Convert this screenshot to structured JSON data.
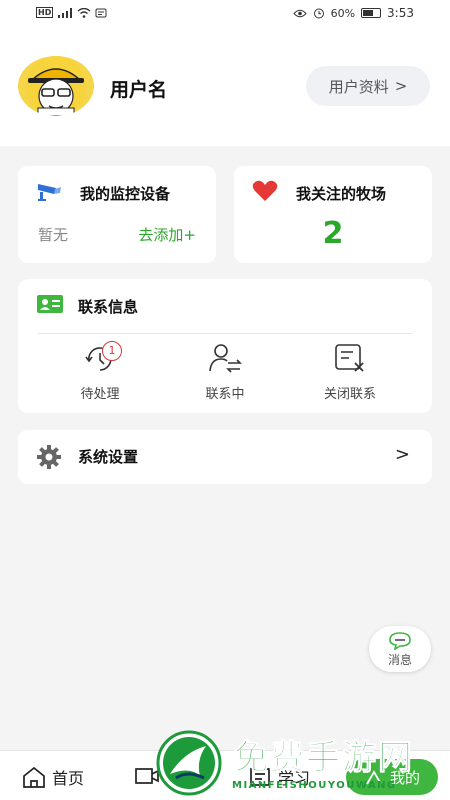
{
  "status_bar": {
    "network": "HD",
    "battery": "60%",
    "battery_level": 0.6,
    "time": "3:53"
  },
  "header": {
    "username": "用户名",
    "profile_button": "用户资料",
    "profile_chevron": ">"
  },
  "devices_card": {
    "title": "我的监控设备",
    "empty_text": "暂无",
    "add_link": "去添加+"
  },
  "ranch_card": {
    "title": "我关注的牧场",
    "count": "2"
  },
  "contact_card": {
    "title": "联系信息",
    "actions": [
      {
        "label": "待处理",
        "badge": "1",
        "icon": "pending-icon"
      },
      {
        "label": "联系中",
        "icon": "contacting-icon"
      },
      {
        "label": "关闭联系",
        "icon": "close-contact-icon"
      }
    ]
  },
  "settings_row": {
    "label": "系统设置",
    "chevron": ">"
  },
  "fab": {
    "label": "消息"
  },
  "tab_bar": {
    "tabs": [
      "首页",
      "设备",
      "学习",
      "我的"
    ],
    "active": "我的"
  },
  "watermark": {
    "text": "免费手游网",
    "subtext": "MIANFEISHOUYOUWANG"
  },
  "colors": {
    "accent": "#2aa82a",
    "tab_active_bg": "#3fb63f",
    "badge": "#d43a3a",
    "heart": "#e53935",
    "device_icon": "#2f6fd6"
  }
}
